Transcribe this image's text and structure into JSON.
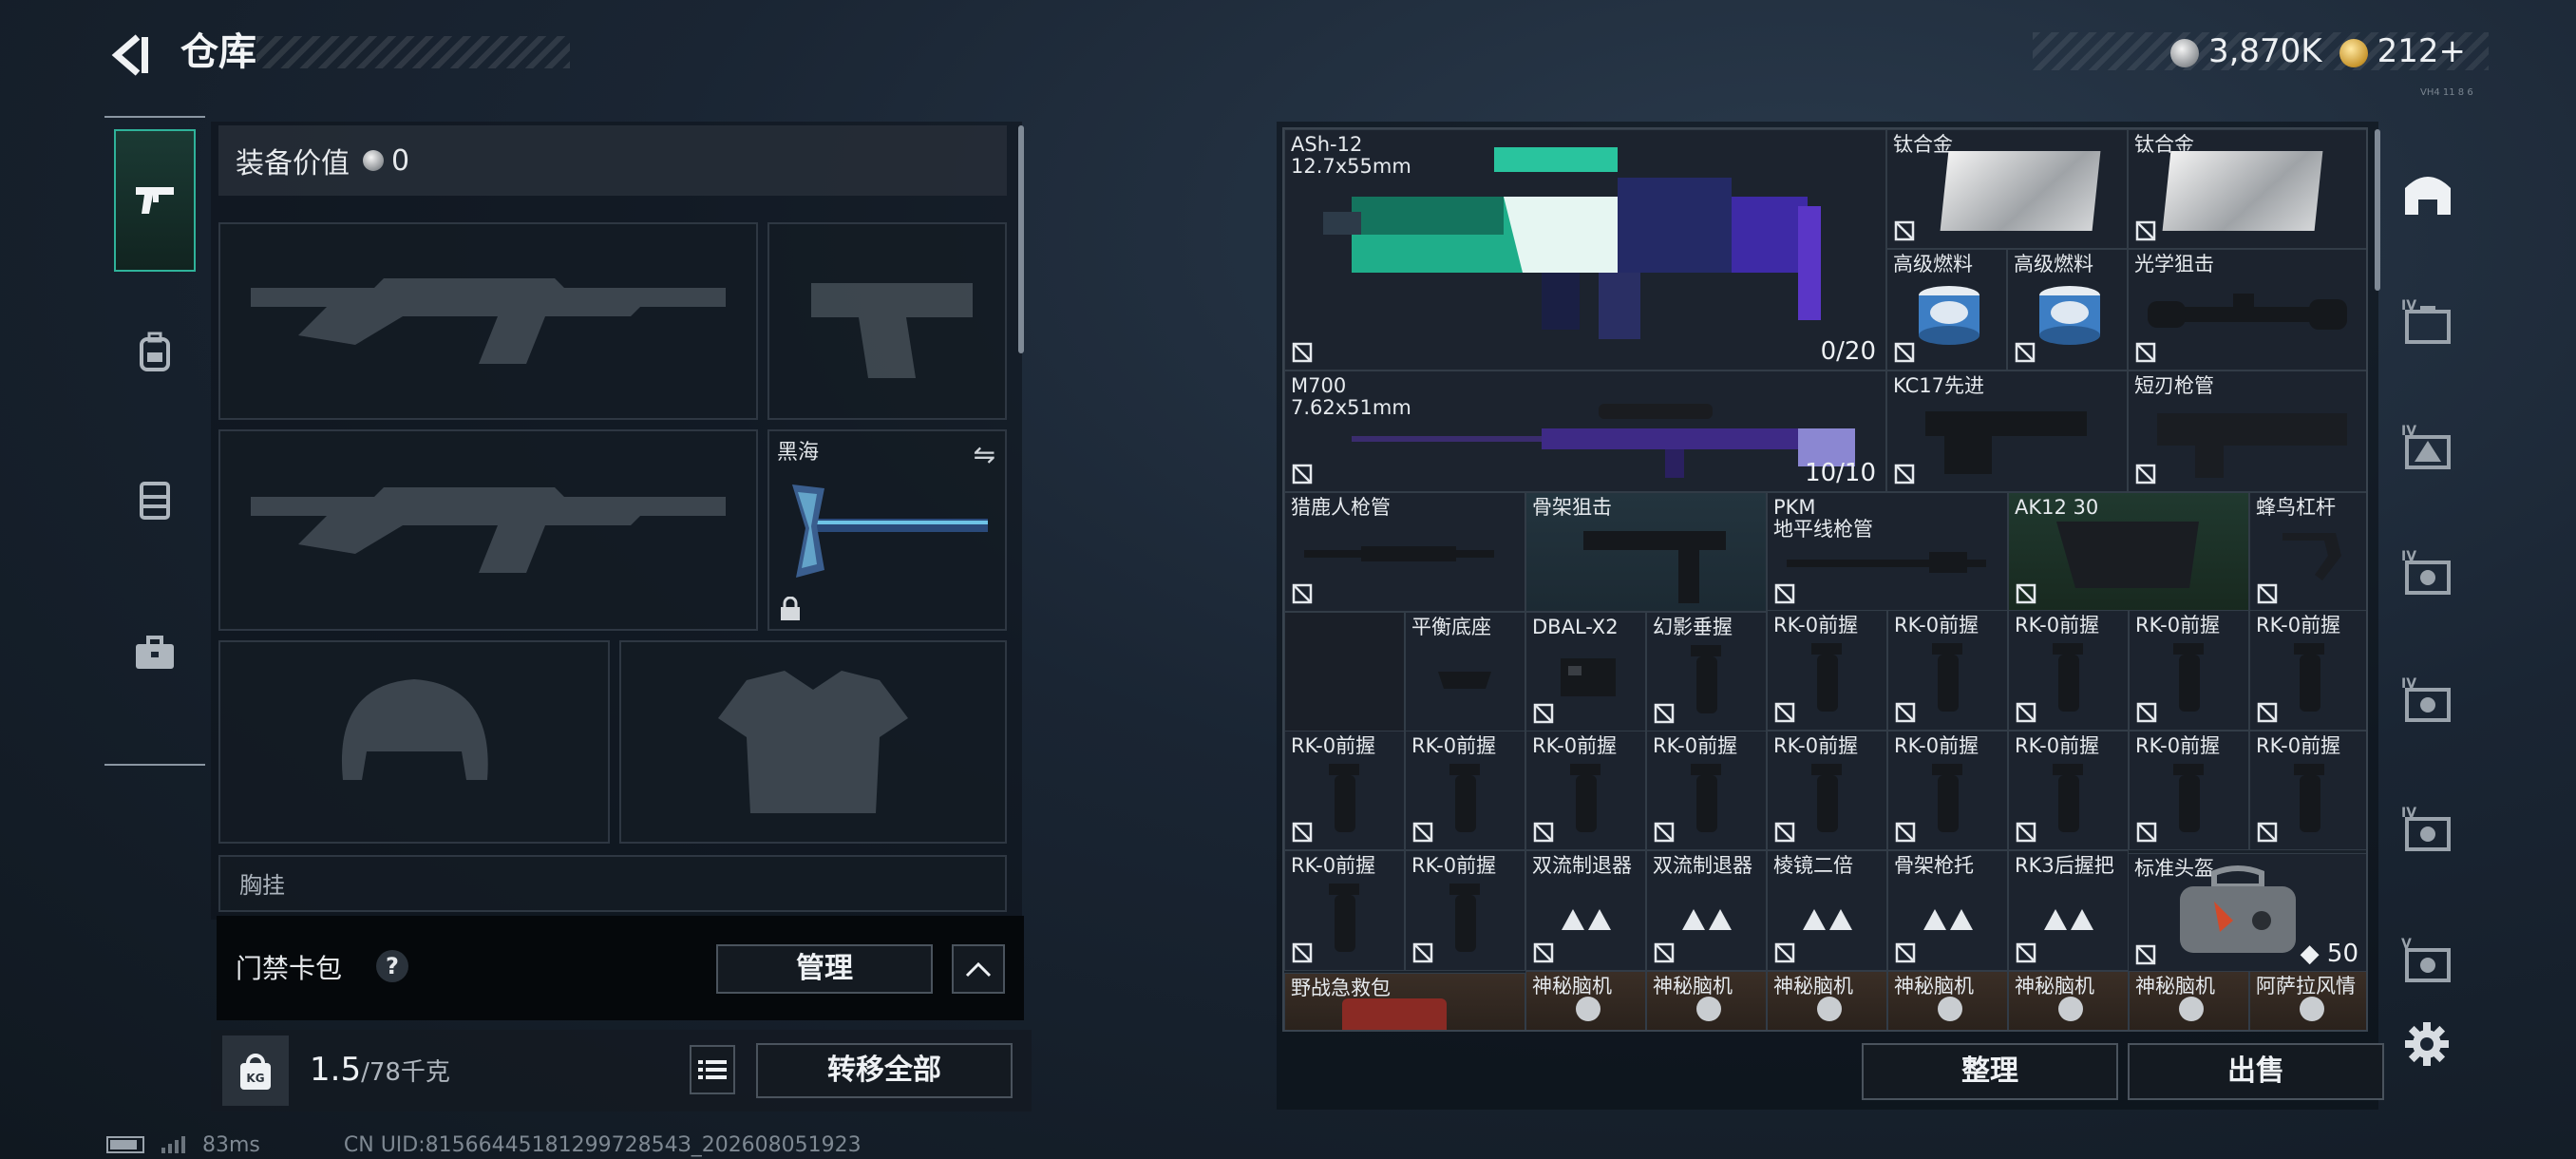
{
  "header": {
    "title": "仓库",
    "currency": [
      {
        "type": "silver",
        "value": "3,870K"
      },
      {
        "type": "gold",
        "value": "212+"
      }
    ],
    "tiny_code": "VH4 11 8 6"
  },
  "left_nav": {
    "items": [
      {
        "icon": "gun-icon",
        "active": true
      },
      {
        "icon": "backpack-icon",
        "active": false
      },
      {
        "icon": "vest-icon",
        "active": false
      },
      {
        "icon": "briefcase-icon",
        "active": false
      }
    ]
  },
  "equipment": {
    "value_label": "装备价值",
    "value_amount": "0",
    "melee_name": "黑海",
    "next_label": "胸挂"
  },
  "access_card": {
    "label": "门禁卡包",
    "help": "?",
    "manage": "管理"
  },
  "weight": {
    "icon": "KG",
    "current": "1.5",
    "max": "/78千克",
    "transfer_all": "转移全部"
  },
  "status": {
    "ping": "83ms",
    "uid": "CN UID:8156644518129972854З_202608051923"
  },
  "inventory": {
    "items": [
      {
        "name": "ASh-12",
        "name2": "12.7x55mm",
        "count": "0/20",
        "kind": "rifle-green"
      },
      {
        "name": "钛合金",
        "kind": "plate"
      },
      {
        "name": "钛合金",
        "kind": "plate"
      },
      {
        "name": "高级燃料",
        "kind": "can"
      },
      {
        "name": "高级燃料",
        "kind": "can"
      },
      {
        "name": "光学狙击",
        "kind": "scope"
      },
      {
        "name": "M700",
        "name2": "7.62x51mm",
        "count": "10/10",
        "kind": "sniper"
      },
      {
        "name": "KC17先进",
        "kind": "stock"
      },
      {
        "name": "短刃枪管",
        "kind": "barrel-short"
      },
      {
        "name": "猎鹿人枪管",
        "kind": "barrel"
      },
      {
        "name": "骨架狙击",
        "kind": "stock-skeleton"
      },
      {
        "name": "PKM",
        "name2": "地平线枪管",
        "kind": "barrel"
      },
      {
        "name": "AK12 30",
        "kind": "mag"
      },
      {
        "name": "蜂鸟杠杆",
        "kind": "lever"
      },
      {
        "name": "平衡底座",
        "kind": "base"
      },
      {
        "name": "DBAL-X2",
        "kind": "laser"
      },
      {
        "name": "幻影垂握",
        "kind": "grip"
      },
      {
        "name": "RK-0前握",
        "kind": "grip"
      },
      {
        "name": "双流制退器",
        "kind": "unknown"
      },
      {
        "name": "棱镜二倍",
        "kind": "unknown"
      },
      {
        "name": "骨架枪托",
        "kind": "unknown"
      },
      {
        "name": "RK3后握把",
        "kind": "unknown"
      },
      {
        "name": "标准头盔",
        "count": "50",
        "kind": "bag"
      },
      {
        "name": "野战急救包",
        "kind": "medkit"
      },
      {
        "name": "神秘脑机",
        "kind": "chip"
      },
      {
        "name": "阿萨拉风情",
        "kind": "chip"
      }
    ],
    "sort": "整理",
    "sell": "出售"
  },
  "right_nav": {
    "items": [
      {
        "icon": "all-items-icon",
        "label": ""
      },
      {
        "icon": "tier-iv-case-icon",
        "label": "IV"
      },
      {
        "icon": "tier-iv-triangle-icon",
        "label": "IV"
      },
      {
        "icon": "tier-iv-box-icon",
        "label": "IV"
      },
      {
        "icon": "tier-iv-box-icon",
        "label": "IV"
      },
      {
        "icon": "tier-iv-box-icon",
        "label": "IV"
      },
      {
        "icon": "tier-v-box-icon",
        "label": "V"
      }
    ]
  },
  "colors": {
    "accent_teal": "#2fb39a",
    "silver_coin": "#a4a8ac",
    "gold_coin": "#c8962e"
  }
}
